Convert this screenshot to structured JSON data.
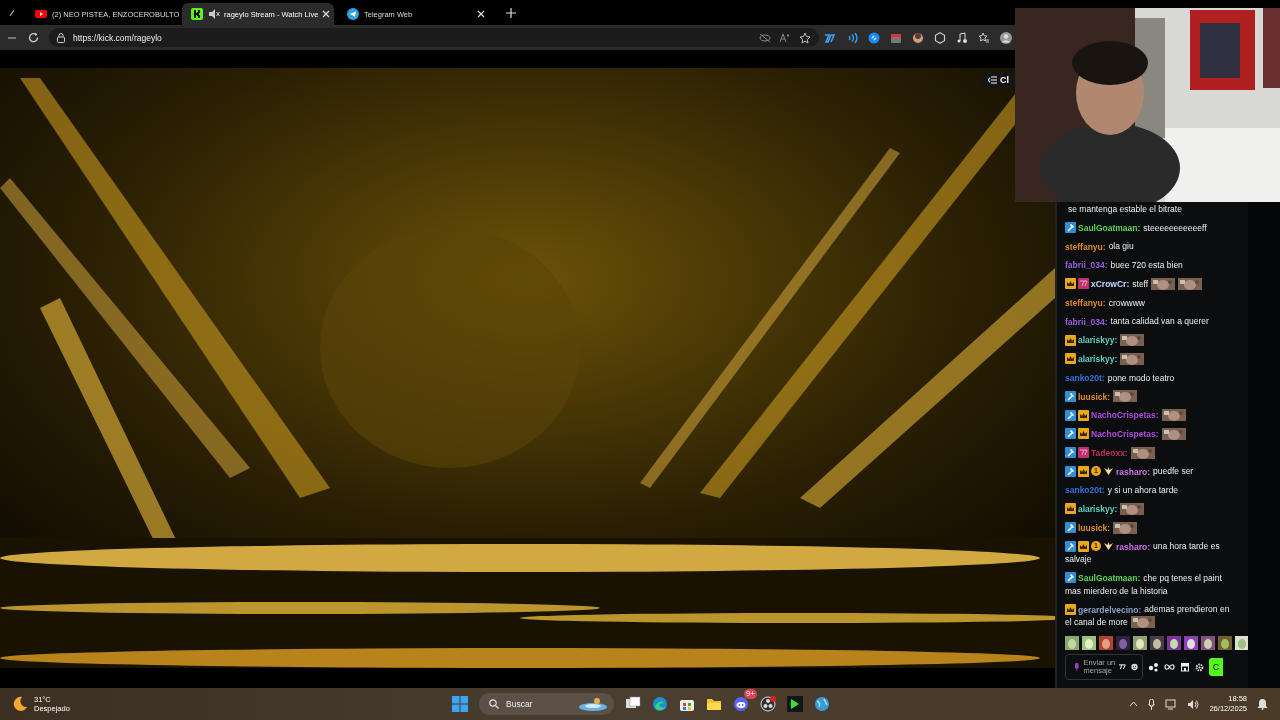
{
  "browser": {
    "tabs": [
      {
        "label": "(2) NEO PISTEA, ENZOCEROBULTO",
        "kind": "youtube",
        "selected": false,
        "muted": false
      },
      {
        "label": "rageylo Stream - Watch Live",
        "kind": "kick",
        "selected": true,
        "muted": true
      },
      {
        "label": "Telegram Web",
        "kind": "telegram",
        "selected": false,
        "muted": false
      }
    ],
    "address": "https://kick.com/rageylo"
  },
  "player": {
    "chat_toggle": "Cl"
  },
  "chat": {
    "messages": [
      {
        "text": "se mantenga estable el bitrate"
      },
      {
        "user": "SaulGoatmaan:",
        "color": "#5bd45b",
        "badges": [
          {
            "kind": "mod"
          }
        ],
        "text": "steeeeeeeeeeeff"
      },
      {
        "user": "steffanyu:",
        "color": "#e08a2b",
        "text": "ola giu"
      },
      {
        "user": "fabrii_034:",
        "color": "#9a5de0",
        "text": "buee 720 esta bien"
      },
      {
        "user": "xCrowCr:",
        "color": "#c8d8ff",
        "badges": [
          {
            "kind": "sub"
          },
          {
            "kind": "seventv"
          }
        ],
        "text": "steff",
        "emotes": [
          {
            "kind": "picture"
          },
          {
            "kind": "picture"
          }
        ]
      },
      {
        "user": "steffanyu:",
        "color": "#e08a2b",
        "text": "crowwww"
      },
      {
        "user": "fabrii_034:",
        "color": "#9a5de0",
        "text": "tanta calidad van a querer"
      },
      {
        "user": "alariskyy:",
        "color": "#5fd0c0",
        "badges": [
          {
            "kind": "sub"
          }
        ],
        "emotes": [
          {
            "kind": "picture"
          }
        ]
      },
      {
        "user": "alariskyy:",
        "color": "#5fd0c0",
        "badges": [
          {
            "kind": "sub"
          }
        ],
        "emotes": [
          {
            "kind": "picture"
          }
        ]
      },
      {
        "user": "sanko20t:",
        "color": "#3b6fd8",
        "text": "pone modo teatro"
      },
      {
        "user": "luusick:",
        "color": "#e0902b",
        "badges": [
          {
            "kind": "mod"
          }
        ],
        "emotes": [
          {
            "kind": "picture"
          }
        ]
      },
      {
        "user": "NachoCrispetas:",
        "color": "#b04ae0",
        "badges": [
          {
            "kind": "mod"
          },
          {
            "kind": "sub"
          }
        ],
        "emotes": [
          {
            "kind": "picture"
          }
        ]
      },
      {
        "user": "NachoCrispetas:",
        "color": "#b04ae0",
        "badges": [
          {
            "kind": "mod"
          },
          {
            "kind": "sub"
          }
        ],
        "emotes": [
          {
            "kind": "picture"
          }
        ]
      },
      {
        "user": "Tadeoxx:",
        "color": "#c0305a",
        "badges": [
          {
            "kind": "mod"
          },
          {
            "kind": "seventv"
          }
        ],
        "emotes": [
          {
            "kind": "picture"
          }
        ]
      },
      {
        "user": "rasharo:",
        "color": "#d070e8",
        "badges": [
          {
            "kind": "mod"
          },
          {
            "kind": "sub"
          },
          {
            "kind": "gift",
            "label": "1"
          },
          {
            "kind": "wing"
          }
        ],
        "text": "puedfe ser"
      },
      {
        "user": "sanko20t:",
        "color": "#3b6fd8",
        "text": "y si un ahora tarde"
      },
      {
        "user": "alariskyy:",
        "color": "#5fd0c0",
        "badges": [
          {
            "kind": "sub"
          }
        ],
        "emotes": [
          {
            "kind": "picture"
          }
        ]
      },
      {
        "user": "luusick:",
        "color": "#e0902b",
        "badges": [
          {
            "kind": "mod"
          }
        ],
        "emotes": [
          {
            "kind": "picture"
          }
        ]
      },
      {
        "user": "rasharo:",
        "color": "#d070e8",
        "badges": [
          {
            "kind": "mod"
          },
          {
            "kind": "sub"
          },
          {
            "kind": "gift",
            "label": "1"
          },
          {
            "kind": "wing"
          }
        ],
        "lines": [
          "una hora tarde es",
          "salvaje"
        ]
      },
      {
        "user": "SaulGoatmaan:",
        "color": "#5bd45b",
        "badges": [
          {
            "kind": "mod"
          }
        ],
        "lines": [
          "che pq tenes el paint",
          "mas mierdero de la historia"
        ]
      },
      {
        "user": "gerardelvecino:",
        "color": "#8aa0c8",
        "badges": [
          {
            "kind": "sub"
          }
        ],
        "lines": [
          "ademas prendieron en",
          "el canal de more"
        ],
        "emotes": [
          {
            "kind": "picture"
          }
        ]
      }
    ],
    "emote_bar": [
      {
        "kind": "picture"
      },
      {
        "kind": "picture"
      },
      {
        "kind": "picture"
      },
      {
        "kind": "picture"
      },
      {
        "kind": "picture"
      },
      {
        "kind": "picture"
      },
      {
        "kind": "picture"
      },
      {
        "kind": "picture"
      },
      {
        "kind": "picture"
      },
      {
        "kind": "picture"
      },
      {
        "kind": "picture"
      }
    ],
    "input": {
      "placeholder_start": "Enviar un",
      "placeholder_end": "mensaje"
    },
    "send_button": "C"
  },
  "taskbar": {
    "weather": {
      "temp": "31°C",
      "condition": "Despejado"
    },
    "search": {
      "placeholder": "Buscar"
    },
    "apps": [
      {
        "kind": "taskview"
      },
      {
        "kind": "edge"
      },
      {
        "kind": "store"
      },
      {
        "kind": "explorer"
      },
      {
        "kind": "discord",
        "badge": "9+"
      },
      {
        "kind": "obs"
      },
      {
        "kind": "green"
      },
      {
        "kind": "globe"
      }
    ],
    "time": "18:58",
    "date": "26/12/2025"
  }
}
